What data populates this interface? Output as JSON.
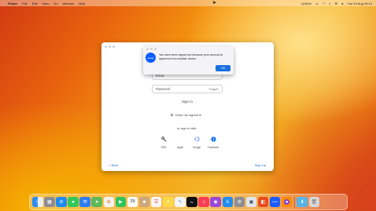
{
  "menubar": {
    "apple_glyph": "",
    "items": [
      "Finder",
      "File",
      "Edit",
      "View",
      "Go",
      "Window",
      "Help"
    ],
    "battery": "(100)%",
    "datetime": "Tue 29 Aug 09:14"
  },
  "login": {
    "email_placeholder": "Email",
    "password_placeholder": "Password",
    "forgot": "Forgot?",
    "sign_in": "Sign In",
    "keep_signed_in": "Keep me signed in",
    "or_sign_in_with": "or sign in with",
    "providers": [
      {
        "label": "SSO",
        "icon": "key-icon"
      },
      {
        "label": "Apple",
        "icon": "apple-icon"
      },
      {
        "label": "Google",
        "icon": "google-icon"
      },
      {
        "label": "Facebook",
        "icon": "facebook-icon"
      }
    ],
    "back": "< Back",
    "sign_up": "Sign Up"
  },
  "alert": {
    "logo_text": "zoom",
    "message": "You have been signed out because your account is signed in from another device",
    "ok": "OK"
  },
  "dock": {
    "calendar_day": "29",
    "apps": [
      {
        "name": "finder",
        "color": "#2f8cf0"
      },
      {
        "name": "launchpad",
        "color": "#8c8c96"
      },
      {
        "name": "safari",
        "color": "#1d8af2"
      },
      {
        "name": "messages",
        "color": "#34c759"
      },
      {
        "name": "mail",
        "color": "#2f7df6"
      },
      {
        "name": "maps",
        "color": "#5fb85a"
      },
      {
        "name": "photos",
        "color": "#f2f2f2"
      },
      {
        "name": "facetime",
        "color": "#32c25a"
      },
      {
        "name": "calendar",
        "color": "#ffffff"
      },
      {
        "name": "contacts",
        "color": "#c9a77c"
      },
      {
        "name": "reminders",
        "color": "#f6f6f6"
      },
      {
        "name": "notes",
        "color": "#fcd849"
      },
      {
        "name": "freeform",
        "color": "#f4f4f4"
      },
      {
        "name": "apple-tv",
        "color": "#111111"
      },
      {
        "name": "music",
        "color": "#fa3c55"
      },
      {
        "name": "podcasts",
        "color": "#9b48d8"
      },
      {
        "name": "app-store",
        "color": "#1e8cf2"
      },
      {
        "name": "system-settings",
        "color": "#8e8e93"
      },
      {
        "name": "preview",
        "color": "#dfe6f0"
      },
      {
        "name": "office",
        "color": "#e84c1e"
      },
      {
        "name": "zoom",
        "color": "#1a5cff"
      },
      {
        "name": "firefox",
        "color": "#ff8a00"
      },
      {
        "name": "downloads-folder",
        "color": "#56b4e8"
      },
      {
        "name": "trash",
        "color": "#d7d7d7"
      }
    ]
  }
}
